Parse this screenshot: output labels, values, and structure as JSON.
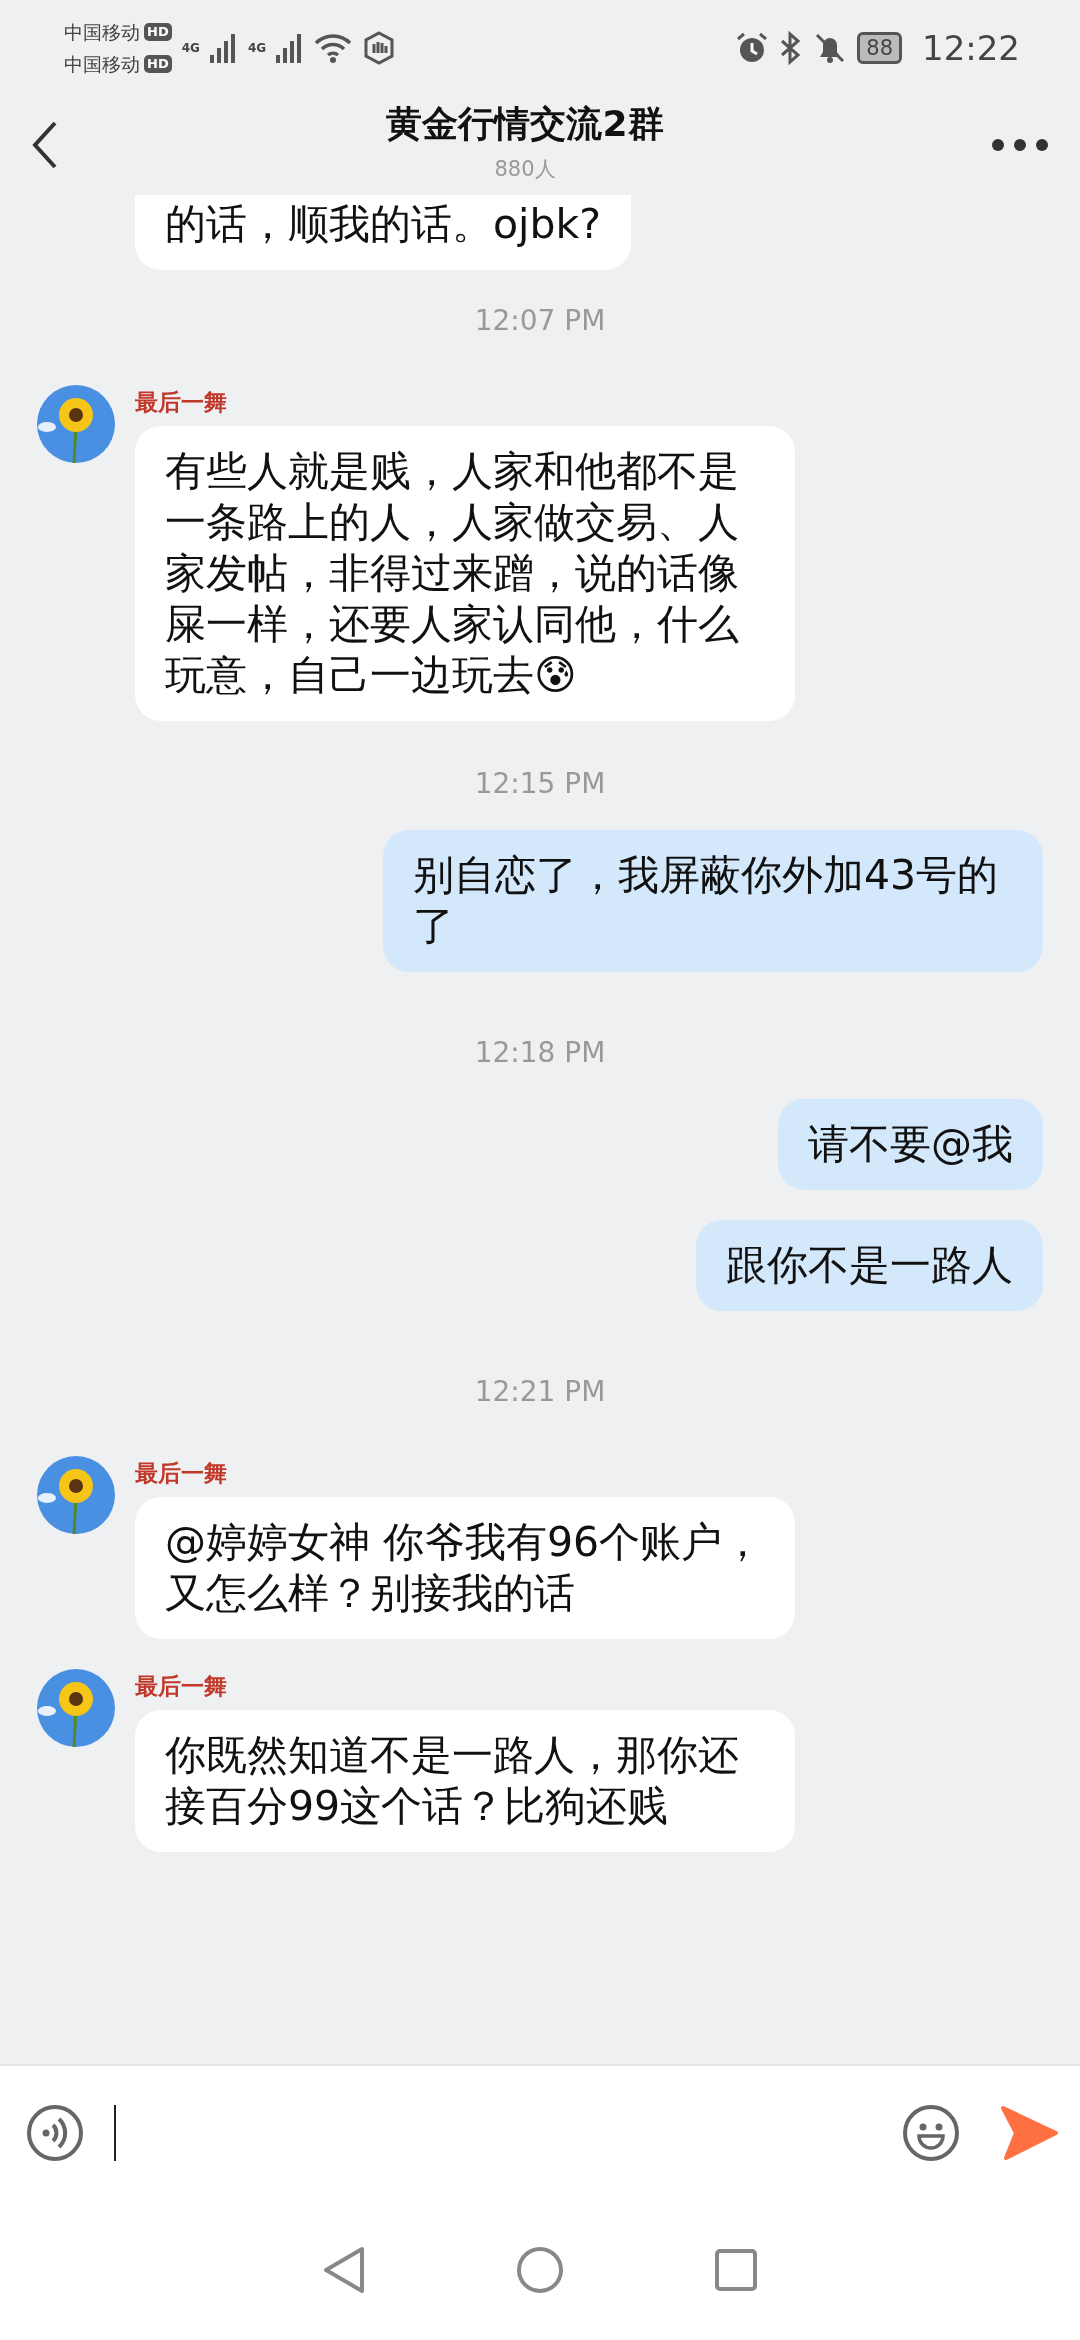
{
  "status_bar": {
    "carrier_1": "中国移动",
    "carrier_2": "中国移动",
    "hd_1": "HD",
    "hd_2": "HD",
    "network_1": "4G",
    "network_2": "4G",
    "battery": "88",
    "time": "12:22"
  },
  "header": {
    "title": "黄金行情交流2群",
    "subtitle": "880人"
  },
  "messages": [
    {
      "kind": "incoming",
      "clipped": true,
      "text": "的话，顺我的话。ojbk?"
    },
    {
      "kind": "time",
      "text": "12:07 PM"
    },
    {
      "kind": "incoming",
      "sender": "最后一舞",
      "text": "有些人就是贱，人家和他都不是一条路上的人，人家做交易、人家发帖，非得过来蹭，说的话像屎一样，还要人家认同他，什么玩意，自己一边玩去😰"
    },
    {
      "kind": "time",
      "text": "12:15 PM"
    },
    {
      "kind": "outgoing",
      "text": "别自恋了，我屏蔽你外加43号的了"
    },
    {
      "kind": "time",
      "text": "12:18 PM"
    },
    {
      "kind": "outgoing",
      "text": "请不要@我"
    },
    {
      "kind": "outgoing",
      "text": "跟你不是一路人"
    },
    {
      "kind": "time",
      "text": "12:21 PM"
    },
    {
      "kind": "incoming",
      "sender": "最后一舞",
      "text": "@婷婷女神 你爷我有96个账户，又怎么样？别接我的话"
    },
    {
      "kind": "incoming",
      "sender": "最后一舞",
      "text": "你既然知道不是一路人，那你还接百分99这个话？比狗还贱"
    }
  ]
}
